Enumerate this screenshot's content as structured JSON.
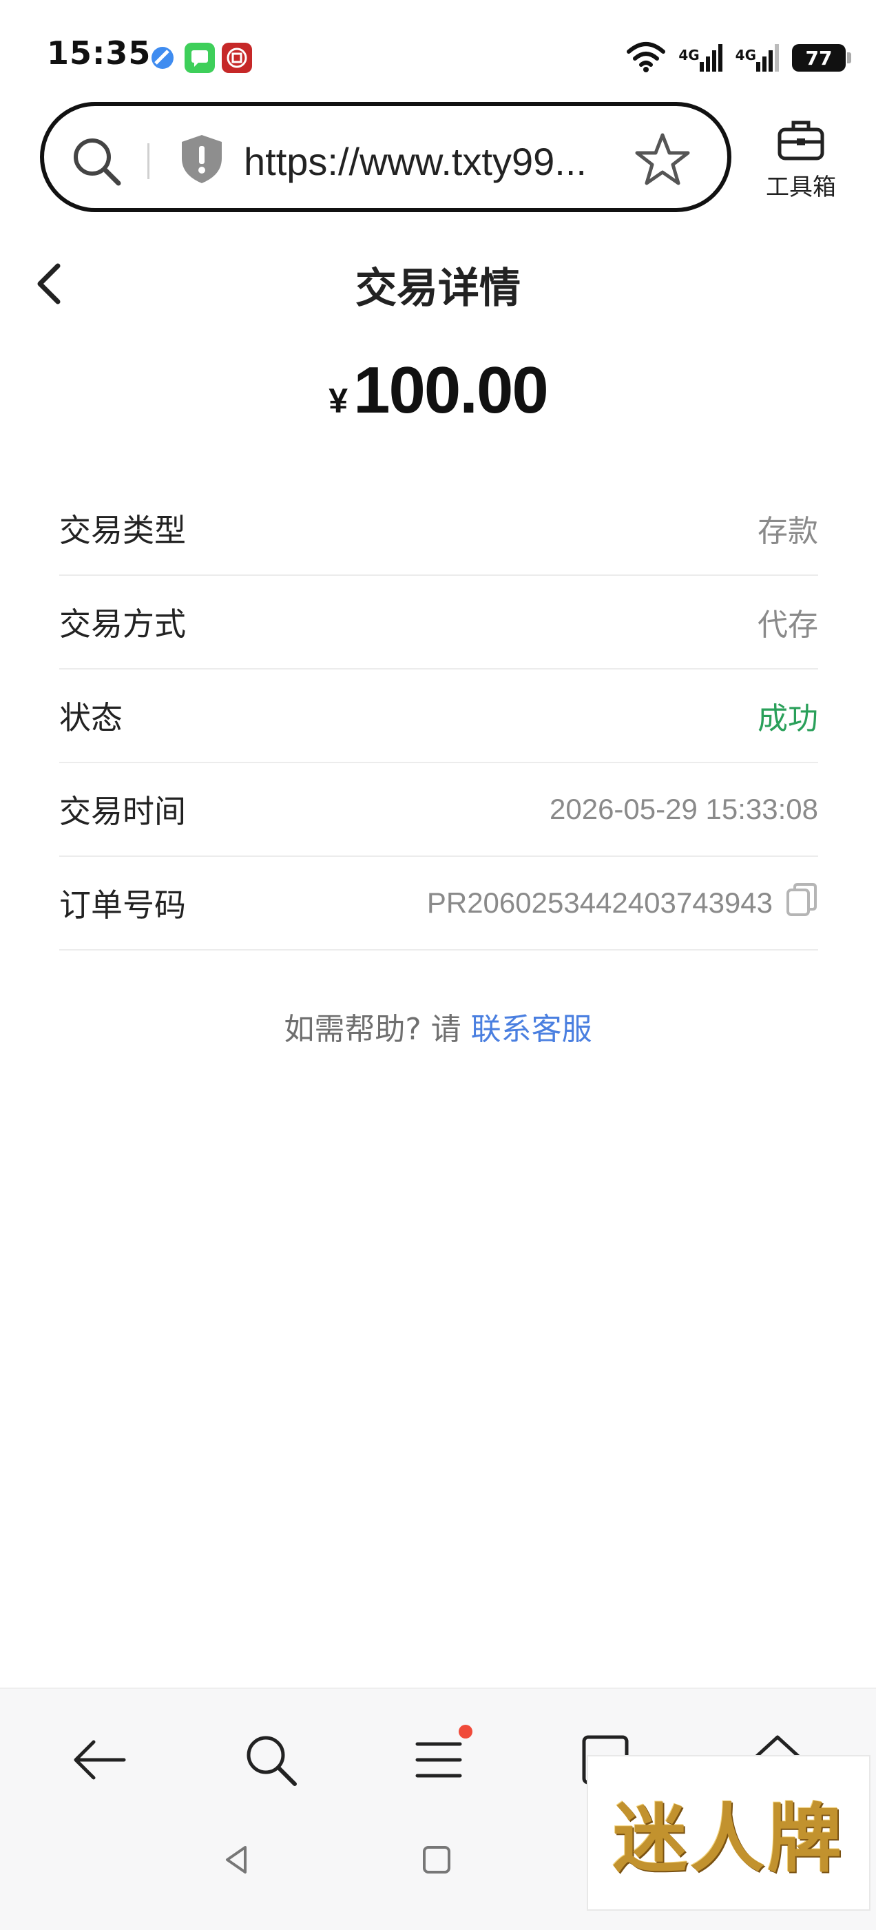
{
  "status_bar": {
    "time": "15:35",
    "network_1": "4G",
    "network_2": "4G",
    "battery": "77",
    "icons": [
      "app-blue-icon",
      "messages-icon",
      "bank-icon",
      "wifi-icon",
      "signal-icon",
      "battery-icon"
    ]
  },
  "browser": {
    "url": "https://www.txty99...",
    "toolbox_label": "工具箱"
  },
  "header": {
    "title": "交易详情"
  },
  "amount": {
    "currency": "¥",
    "value": "100.00"
  },
  "details": [
    {
      "label": "交易类型",
      "value": "存款"
    },
    {
      "label": "交易方式",
      "value": "代存"
    },
    {
      "label": "状态",
      "value": "成功"
    },
    {
      "label": "交易时间",
      "value": "2026-05-29 15:33:08"
    },
    {
      "label": "订单号码",
      "value": "PR2060253442403743943"
    }
  ],
  "help": {
    "prefix": "如需帮助? 请 ",
    "link": "联系客服"
  },
  "watermark": {
    "text": "迷人牌"
  },
  "colors": {
    "success": "#2aa05a",
    "link": "#4a7fe0",
    "notification_dot": "#f04a3a"
  }
}
